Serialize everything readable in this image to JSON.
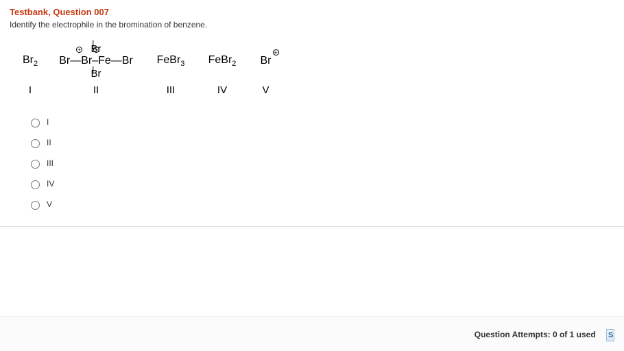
{
  "title": "Testbank, Question 007",
  "prompt": "Identify the electrophile in the bromination of benzene.",
  "formulas": {
    "i_html": "Br<sub>2</sub>",
    "ii_top": "Br",
    "ii_main": "Br—Br–Fe—Br",
    "ii_bot": "Br",
    "iii_html": "FeBr<sub>3</sub>",
    "iv_html": "FeBr<sub>2</sub>",
    "v_main": "Br",
    "v_sup": "+"
  },
  "labels": {
    "i": "I",
    "ii": "II",
    "iii": "III",
    "iv": "IV",
    "v": "V"
  },
  "options": [
    {
      "id": "opt1",
      "label": "I"
    },
    {
      "id": "opt2",
      "label": "II"
    },
    {
      "id": "opt3",
      "label": "III"
    },
    {
      "id": "opt4",
      "label": "IV"
    },
    {
      "id": "opt5",
      "label": "V"
    }
  ],
  "footer": {
    "attempts_label": "Question Attempts: 0 of 1 used",
    "button_hint": "S"
  }
}
